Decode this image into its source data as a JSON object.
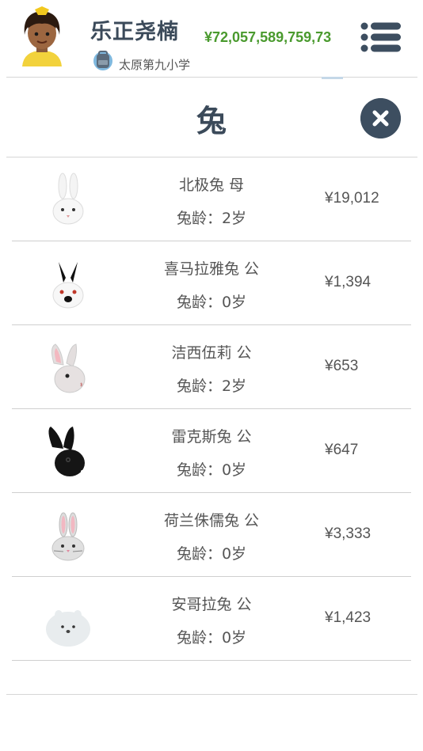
{
  "header": {
    "user_name": "乐正尧楠",
    "school": "太原第九小学",
    "money": "¥72,057,589,759,73"
  },
  "panel": {
    "title": "兔"
  },
  "rabbits": [
    {
      "name": "北极兔 母",
      "age": "兔龄：2岁",
      "price": "¥19,012",
      "icon": "white-rabbit-icon"
    },
    {
      "name": "喜马拉雅兔 公",
      "age": "兔龄：0岁",
      "price": "¥1,394",
      "icon": "himalayan-rabbit-icon"
    },
    {
      "name": "洁西伍莉 公",
      "age": "兔龄：2岁",
      "price": "¥653",
      "icon": "jersey-wooly-rabbit-icon"
    },
    {
      "name": "雷克斯兔 公",
      "age": "兔龄：0岁",
      "price": "¥647",
      "icon": "black-rex-rabbit-icon"
    },
    {
      "name": "荷兰侏儒兔 公",
      "age": "兔龄：0岁",
      "price": "¥3,333",
      "icon": "dwarf-rabbit-icon"
    },
    {
      "name": "安哥拉兔 公",
      "age": "兔龄：0岁",
      "price": "¥1,423",
      "icon": "angora-rabbit-icon"
    }
  ],
  "colors": {
    "money": "#4a9a2e",
    "title": "#3b4a5a",
    "close_button": "#3d4e60"
  }
}
